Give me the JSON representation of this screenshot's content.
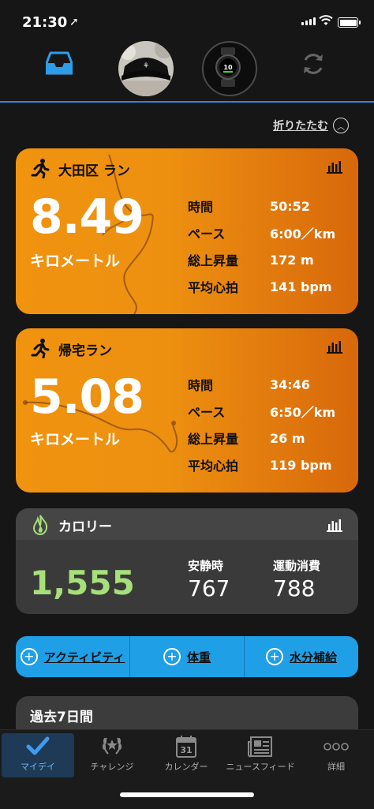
{
  "status": {
    "time": "21:30"
  },
  "header": {
    "collapse_label": "折りたたむ"
  },
  "runs": [
    {
      "title": "大田区 ラン",
      "distance": "8.49",
      "unit": "キロメートル",
      "stats": [
        {
          "label": "時間",
          "value": "50:52"
        },
        {
          "label": "ペース",
          "value": "6:00／km"
        },
        {
          "label": "総上昇量",
          "value": "172 m"
        },
        {
          "label": "平均心拍",
          "value": "141 bpm"
        }
      ]
    },
    {
      "title": "帰宅ラン",
      "distance": "5.08",
      "unit": "キロメートル",
      "stats": [
        {
          "label": "時間",
          "value": "34:46"
        },
        {
          "label": "ペース",
          "value": "6:50／km"
        },
        {
          "label": "総上昇量",
          "value": "26 m"
        },
        {
          "label": "平均心拍",
          "value": "119 bpm"
        }
      ]
    }
  ],
  "calories": {
    "title": "カロリー",
    "total": "1,555",
    "resting_label": "安静時",
    "resting_value": "767",
    "active_label": "運動消費",
    "active_value": "788"
  },
  "actions": [
    {
      "label": "アクティビティ"
    },
    {
      "label": "体重"
    },
    {
      "label": "水分補給"
    }
  ],
  "past": {
    "title": "過去7日間"
  },
  "tabs": [
    {
      "label": "マイデイ",
      "icon": "check-icon"
    },
    {
      "label": "チャレンジ",
      "icon": "laurel-icon"
    },
    {
      "label": "カレンダー",
      "icon": "calendar-icon",
      "day": "31"
    },
    {
      "label": "ニュースフィード",
      "icon": "newspaper-icon"
    },
    {
      "label": "詳細",
      "icon": "more-icon"
    }
  ],
  "colors": {
    "accent": "#2d86d8",
    "card_orange": "#f0930f",
    "calorie_green": "#a7e07a",
    "action_blue": "#1e9fe6"
  }
}
